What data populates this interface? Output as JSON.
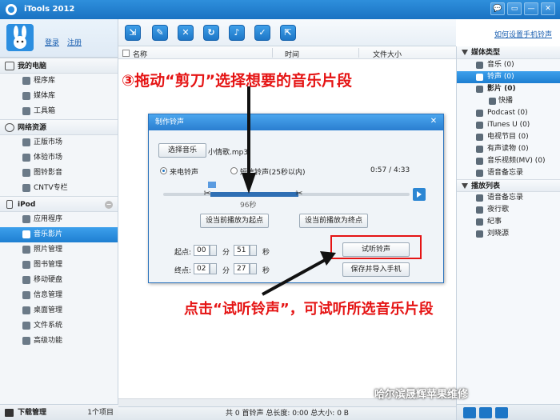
{
  "app": {
    "title": "iTools 2012"
  },
  "window_buttons": [
    "💬",
    "▭",
    "—",
    "✕"
  ],
  "user": {
    "login": "登录",
    "register": "注册"
  },
  "sidebar": {
    "sections": [
      {
        "title": "我的电脑",
        "items": [
          "程序库",
          "媒体库",
          "工具箱"
        ]
      },
      {
        "title": "网络资源",
        "items": [
          "正版市场",
          "体验市场",
          "图铃影音",
          "CNTV专栏"
        ]
      },
      {
        "title": "iPod",
        "items": [
          "应用程序",
          "音乐影片",
          "照片管理",
          "图书管理",
          "移动硬盘",
          "信息管理",
          "桌面管理",
          "文件系统",
          "高级功能"
        ]
      }
    ],
    "active_item": "音乐影片",
    "download": {
      "label": "下载管理",
      "count": "1个项目"
    }
  },
  "toolbar": {
    "icons": [
      "import-icon",
      "edit-icon",
      "delete-icon",
      "refresh-icon",
      "bell-icon",
      "check-icon",
      "export-icon"
    ],
    "help_link": "如何设置手机铃声"
  },
  "list": {
    "columns": [
      "名称",
      "时间",
      "文件大小"
    ]
  },
  "statusbar": {
    "text": "共 0 首铃声   总长度: 0:00   总大小: 0 B"
  },
  "right_panel": {
    "media_header": "媒体类型",
    "media_items": [
      {
        "label": "音乐 (0)",
        "sub": false,
        "active": false,
        "bold": false
      },
      {
        "label": "铃声 (0)",
        "sub": false,
        "active": true,
        "bold": false
      },
      {
        "label": "影片 (0)",
        "sub": false,
        "active": false,
        "bold": true
      },
      {
        "label": "快播",
        "sub": true,
        "active": false,
        "bold": false
      },
      {
        "label": "Podcast (0)",
        "sub": false,
        "active": false,
        "bold": false
      },
      {
        "label": "iTunes U (0)",
        "sub": false,
        "active": false,
        "bold": false
      },
      {
        "label": "电视节目 (0)",
        "sub": false,
        "active": false,
        "bold": false
      },
      {
        "label": "有声读物 (0)",
        "sub": false,
        "active": false,
        "bold": false
      },
      {
        "label": "音乐视频(MV) (0)",
        "sub": false,
        "active": false,
        "bold": false
      },
      {
        "label": "语音备忘录",
        "sub": false,
        "active": false,
        "bold": false
      }
    ],
    "playlist_header": "播放列表",
    "playlist_items": [
      "语音备忘录",
      "夜行歌",
      "纪事",
      "刘晓源"
    ]
  },
  "dialog": {
    "title": "制作铃声",
    "close": "✕",
    "select_button": "选择音乐",
    "filename": "小情歌.mp3",
    "radio_ringtone": "来电铃声",
    "radio_sms": "短信铃声(25秒以内)",
    "time": "0:57 / 4:33",
    "duration": "96秒",
    "set_start": "设当前播放为起点",
    "set_end": "设当前播放为终点",
    "start_label": "起点:",
    "end_label": "终点:",
    "start_min": "00",
    "start_sec": "51",
    "end_min": "02",
    "end_sec": "27",
    "min_unit": "分",
    "sec_unit": "秒",
    "preview_button": "试听铃声",
    "save_button": "保存并导入手机",
    "selection": {
      "start_fraction": 0.19,
      "end_fraction": 0.55
    }
  },
  "annotations": {
    "top": "③拖动“剪刀”选择想要的音乐片段",
    "bottom": "点击“试听铃声”，可试听所选音乐片段"
  },
  "watermark": "哈尔滨晟辉苹果维修"
}
